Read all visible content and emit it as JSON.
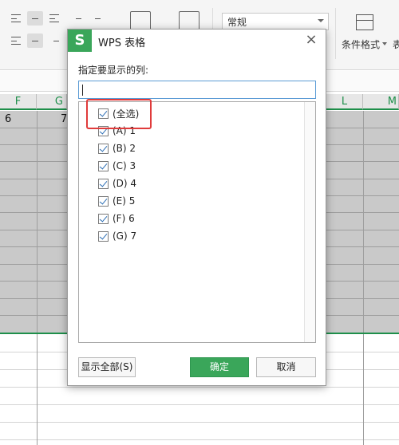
{
  "ribbon": {
    "number_format_value": "常规",
    "conditional_format_label": "条件格式",
    "next_group_label": "表"
  },
  "sheet": {
    "columns": [
      "F",
      "G",
      "L",
      "M"
    ],
    "row1_values": [
      "6",
      "7"
    ]
  },
  "dialog": {
    "title": "WPS 表格",
    "prompt": "指定要显示的列:",
    "search_value": "",
    "items": [
      {
        "label": "(全选)",
        "checked": true
      },
      {
        "label": "(A) 1",
        "checked": true
      },
      {
        "label": "(B) 2",
        "checked": true
      },
      {
        "label": "(C) 3",
        "checked": true
      },
      {
        "label": "(D) 4",
        "checked": true
      },
      {
        "label": "(E) 5",
        "checked": true
      },
      {
        "label": "(F) 6",
        "checked": true
      },
      {
        "label": "(G) 7",
        "checked": true
      }
    ],
    "show_all_label": "显示全部(S)",
    "ok_label": "确定",
    "cancel_label": "取消",
    "close_symbol": "×"
  },
  "colors": {
    "accent_green": "#3aa65a",
    "highlight_red": "#e03b3b",
    "selection_gray": "#c9c9c9"
  }
}
